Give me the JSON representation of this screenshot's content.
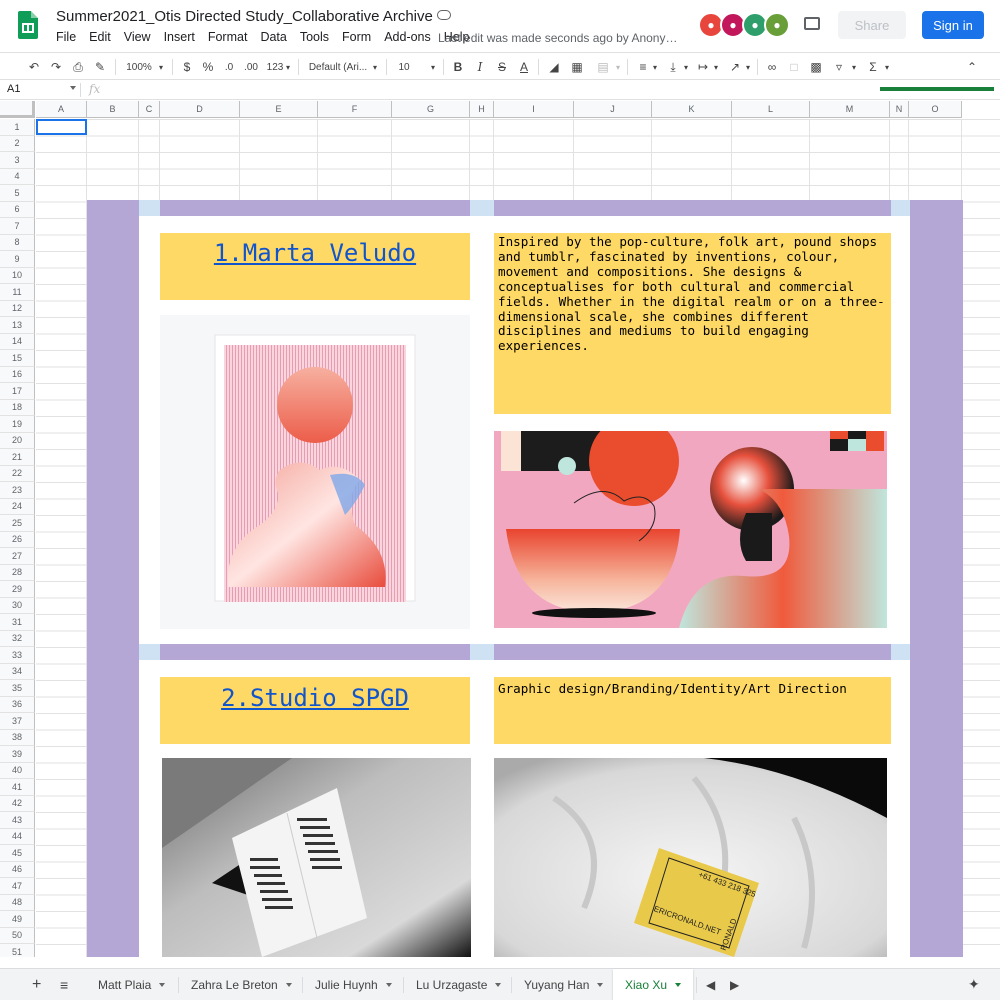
{
  "app": {
    "doc_title": "Summer2021_Otis Directed Study_Collaborative Archive",
    "last_edit": "Last edit was made seconds ago by Anonymous ...",
    "share_label": "Share",
    "signin_label": "Sign in"
  },
  "menu": [
    "File",
    "Edit",
    "View",
    "Insert",
    "Format",
    "Data",
    "Tools",
    "Form",
    "Add-ons",
    "Help"
  ],
  "toolbar": {
    "zoom": "100%",
    "currency": "$",
    "percent": "%",
    "dec_decrease": ".0",
    "dec_increase": ".00",
    "format_more": "123",
    "font": "Default (Ari...",
    "font_size": "10"
  },
  "formula_bar": {
    "name_box": "A1",
    "fx": "fx"
  },
  "columns": [
    "A",
    "B",
    "C",
    "D",
    "E",
    "F",
    "G",
    "H",
    "I",
    "J",
    "K",
    "L",
    "M",
    "N",
    "O"
  ],
  "rows": [
    "1",
    "2",
    "3",
    "4",
    "5",
    "6",
    "7",
    "8",
    "9",
    "10",
    "11",
    "12",
    "13",
    "14",
    "15",
    "16",
    "17",
    "18",
    "19",
    "20",
    "21",
    "22",
    "23",
    "24",
    "25",
    "26",
    "27",
    "28",
    "29",
    "30",
    "31",
    "32",
    "33",
    "34",
    "35",
    "36",
    "37",
    "38",
    "39",
    "40",
    "41",
    "42",
    "43",
    "44",
    "45",
    "46",
    "47",
    "48",
    "49",
    "50",
    "51"
  ],
  "entries": [
    {
      "title": "1.Marta Veludo",
      "description": "Inspired by the pop-culture, folk art, pound shops and tumblr, fascinated by inventions, colour, movement and compositions. She designs & conceptualises for both cultural and commercial fields. Whether in the digital realm or on a three-dimensional scale, she combines different disciplines and mediums to build engaging experiences."
    },
    {
      "title": "2.Studio SPGD",
      "description": "Graphic design/Branding/Identity/Art Direction"
    }
  ],
  "card_text": {
    "phone": "+61 433 218 325",
    "site": "ERICRONALD.NET",
    "name": "RONALD"
  },
  "sheet_tabs": [
    "Matt Plaia",
    "Zahra Le Breton",
    "Julie Huynh",
    "Lu Urzagaste",
    "Yuyang Han",
    "Xiao Xu"
  ],
  "active_tab": "Xiao Xu",
  "colors": {
    "purple": "#b4a7d6",
    "yellow": "#ffd966",
    "light_blue": "#cfe2f3",
    "link": "#1155cc",
    "brand_green": "#0f9d58",
    "signin_blue": "#1a73e8"
  }
}
